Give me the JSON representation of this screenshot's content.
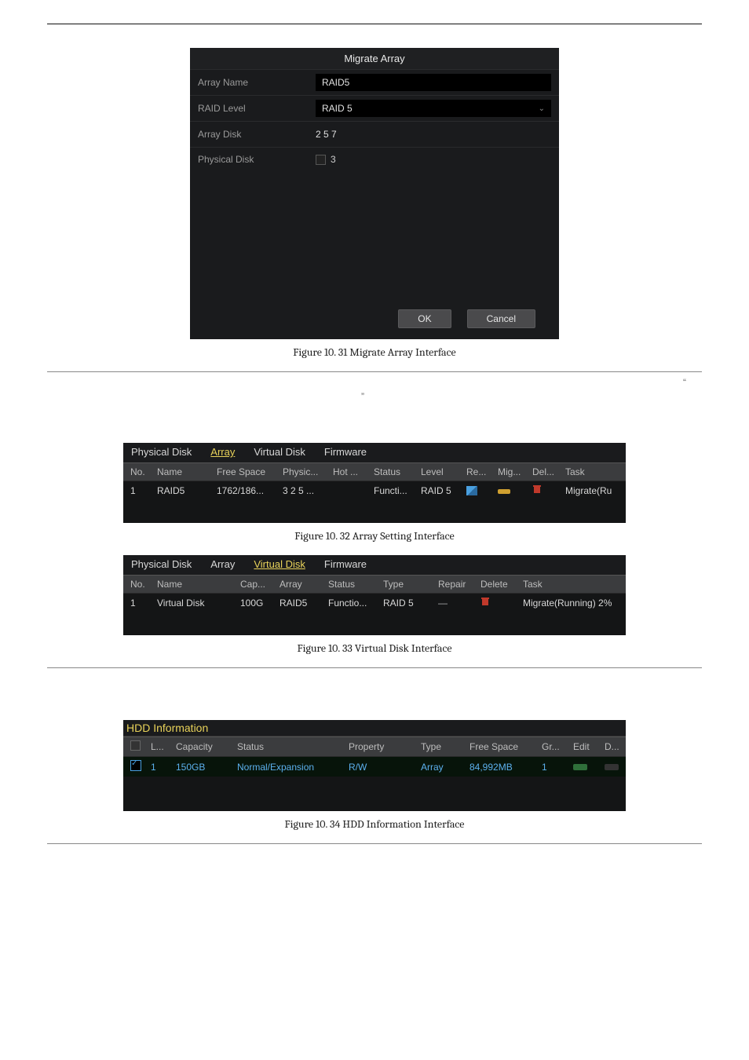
{
  "migrate": {
    "title": "Migrate Array",
    "rows": {
      "name_label": "Array Name",
      "name_value": "RAID5",
      "level_label": "RAID Level",
      "level_value": "RAID 5",
      "disk_label": "Array Disk",
      "disk_value": "2  5  7",
      "phys_label": "Physical Disk",
      "phys_option": "3"
    },
    "ok": "OK",
    "cancel": "Cancel"
  },
  "captions": {
    "fig31": "Figure 10. 31  Migrate Array Interface",
    "fig32": "Figure 10. 32 Array Setting Interface",
    "fig33": "Figure 10. 33 Virtual Disk Interface",
    "fig34": "Figure 10. 34 HDD Information Interface"
  },
  "quotes": {
    "open": "“",
    "close": "”"
  },
  "tabs": {
    "physical": "Physical Disk",
    "array": "Array",
    "virtual": "Virtual Disk",
    "firmware": "Firmware"
  },
  "array_table": {
    "headers": {
      "no": "No.",
      "name": "Name",
      "free": "Free Space",
      "physic": "Physic...",
      "hot": "Hot ...",
      "status": "Status",
      "level": "Level",
      "re": "Re...",
      "mig": "Mig...",
      "del": "Del...",
      "task": "Task"
    },
    "row": {
      "no": "1",
      "name": "RAID5",
      "free": "1762/186...",
      "physic": "3  2  5 ...",
      "hot": "",
      "status": "Functi...",
      "level": "RAID 5",
      "task": "Migrate(Ru"
    }
  },
  "vdisk_table": {
    "headers": {
      "no": "No.",
      "name": "Name",
      "cap": "Cap...",
      "array": "Array",
      "status": "Status",
      "type": "Type",
      "repair": "Repair",
      "delete": "Delete",
      "task": "Task"
    },
    "row": {
      "no": "1",
      "name": "Virtual Disk",
      "cap": "100G",
      "array": "RAID5",
      "status": "Functio...",
      "type": "RAID 5",
      "repair": "—",
      "task": "Migrate(Running) 2%"
    }
  },
  "hdd": {
    "title": "HDD Information",
    "headers": {
      "l": "L...",
      "capacity": "Capacity",
      "status": "Status",
      "property": "Property",
      "type": "Type",
      "free": "Free Space",
      "gr": "Gr...",
      "edit": "Edit",
      "d": "D..."
    },
    "row": {
      "l": "1",
      "capacity": "150GB",
      "status": "Normal/Expansion",
      "property": "R/W",
      "type": "Array",
      "free": "84,992MB",
      "gr": "1"
    }
  }
}
